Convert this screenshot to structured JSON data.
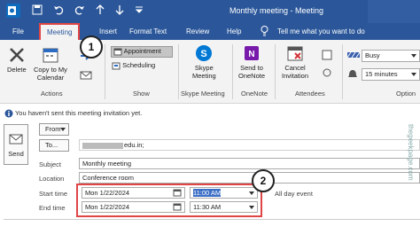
{
  "window_title": "Monthly meeting  -  Meeting",
  "tabs": [
    "File",
    "Meeting",
    "Insert",
    "Format Text",
    "Review",
    "Help"
  ],
  "tell_me": "Tell me what you want to do",
  "ribbon": {
    "delete": "Delete",
    "copy_line1": "Copy to My",
    "copy_line2": "Calendar",
    "actions_label": "Actions",
    "appointment": "Appointment",
    "scheduling": "Scheduling",
    "show_label": "Show",
    "skype_line1": "Skype",
    "skype_line2": "Meeting",
    "skype_group": "Skype Meeting",
    "onenote_line1": "Send to",
    "onenote_line2": "OneNote",
    "onenote_group": "OneNote",
    "cancel_line1": "Cancel",
    "cancel_line2": "Invitation",
    "attendees_label": "Attendees",
    "busy": "Busy",
    "reminder": "15 minutes",
    "options_label": "Option"
  },
  "info": "You haven't sent this meeting invitation yet.",
  "form": {
    "send": "Send",
    "from": "From",
    "to": "To...",
    "to_value": "edu.in;",
    "subject_label": "Subject",
    "subject": "Monthly meeting",
    "location_label": "Location",
    "location": "Conference room",
    "start_label": "Start time",
    "start_date": "Mon 1/22/2024",
    "start_time": "11:00 AM",
    "allday": "All day event",
    "end_label": "End time",
    "end_date": "Mon 1/22/2024",
    "end_time": "11:30 AM"
  },
  "badges": [
    "1",
    "2"
  ],
  "watermark": "thegeekpage.com",
  "colors": {
    "accent": "#2b579a",
    "highlight": "#e04545"
  }
}
